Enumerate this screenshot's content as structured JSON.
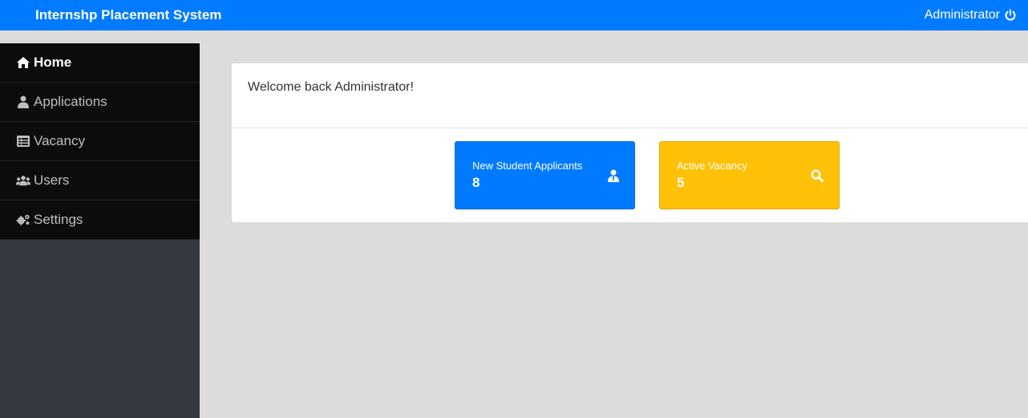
{
  "header": {
    "title": "Internshp Placement System",
    "user": "Administrator",
    "user_icon": "power-icon"
  },
  "sidebar": {
    "items": [
      {
        "label": "Home",
        "icon": "home-icon",
        "active": true
      },
      {
        "label": "Applications",
        "icon": "user-tie-icon"
      },
      {
        "label": "Vacancy",
        "icon": "list-icon"
      },
      {
        "label": "Users",
        "icon": "users-icon"
      },
      {
        "label": "Settings",
        "icon": "cogs-icon"
      }
    ]
  },
  "main": {
    "welcome": "Welcome back Administrator!",
    "tiles": [
      {
        "label": "New Student Applicants",
        "count": "8",
        "icon": "user-tie-icon",
        "color": "#007bff"
      },
      {
        "label": "Active Vacancy",
        "count": "5",
        "icon": "search-icon",
        "color": "#ffc107"
      }
    ]
  },
  "colors": {
    "primary": "#007bff",
    "warning": "#ffc107",
    "sidebar": "#343a40",
    "menu_bg": "#0c0c0c",
    "page_bg": "#dcdcdc"
  }
}
